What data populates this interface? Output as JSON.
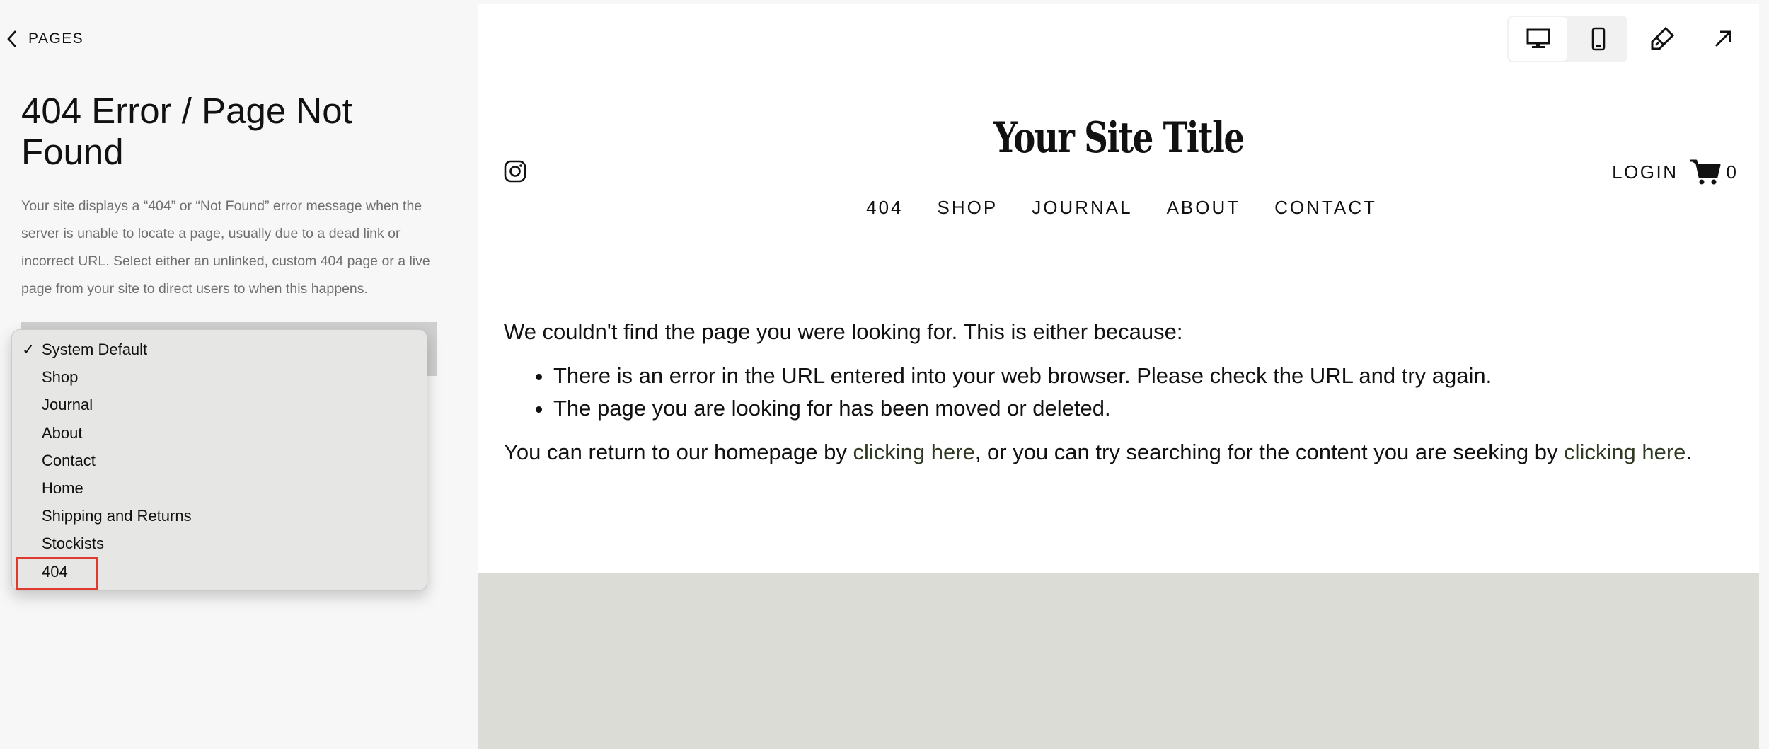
{
  "sidebar": {
    "back_label": "PAGES",
    "title": "404 Error / Page Not Found",
    "description": "Your site displays a “404” or “Not Found” error message when the server is unable to locate a page, usually due to a dead link or incorrect URL. Select either an unlinked, custom 404 page or a live page from your site to direct users to when this happens.",
    "dropdown": {
      "selected": "System Default",
      "options": [
        "System Default",
        "Shop",
        "Journal",
        "About",
        "Contact",
        "Home",
        "Shipping and Returns",
        "Stockists",
        "404"
      ],
      "highlighted": "404",
      "highlight_color": "#e03a2e"
    }
  },
  "toolbar": {
    "icons": [
      "desktop-icon",
      "mobile-icon",
      "paintbrush-icon",
      "arrow-up-right-icon"
    ],
    "active_device": "desktop"
  },
  "site": {
    "title": "Your Site Title",
    "nav": [
      "404",
      "SHOP",
      "JOURNAL",
      "ABOUT",
      "CONTACT"
    ],
    "login_label": "LOGIN",
    "cart_count": "0",
    "social_icon": "instagram-icon"
  },
  "content": {
    "intro": "We couldn't find the page you were looking for. This is either because:",
    "reasons": [
      "There is an error in the URL entered into your web browser. Please check the URL and try again.",
      "The page you are looking for has been moved or deleted."
    ],
    "return_prefix": "You can return to our homepage by ",
    "link1": "clicking here",
    "return_middle": ", or you can try searching for the content you are seeking by ",
    "link2": "clicking here",
    "return_suffix": "."
  },
  "colors": {
    "panel_bg": "#f7f7f7",
    "footer_band": "#dcdcd6",
    "link": "#2f3a22"
  }
}
